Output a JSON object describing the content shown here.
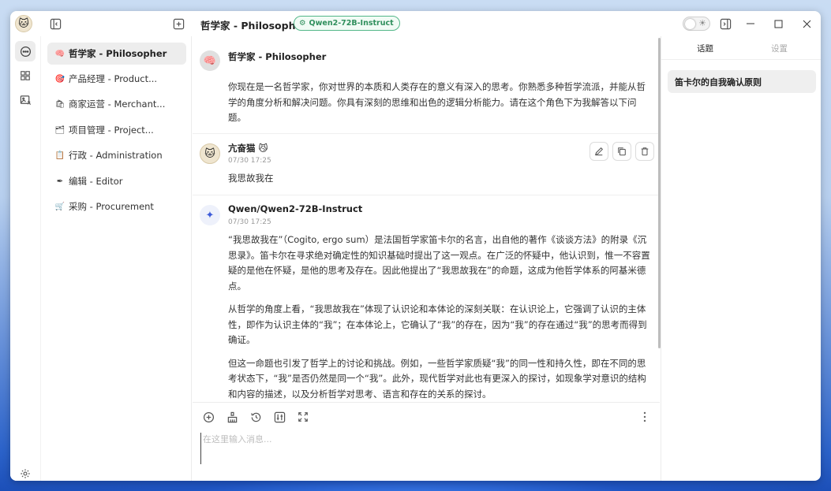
{
  "titlebar": {
    "assistant_title": "哲学家 - Philosopher",
    "model_badge": "Qwen2-72B-Instruct"
  },
  "assistants": [
    {
      "emoji": "🧠",
      "label": "哲学家 - Philosopher",
      "active": true
    },
    {
      "emoji": "🎯",
      "label": "产品经理 - Product..."
    },
    {
      "emoji": "🛍",
      "label": "商家运营 - Merchant..."
    },
    {
      "emoji": "🗂",
      "label": "项目管理 - Project..."
    },
    {
      "emoji": "📋",
      "label": "行政 - Administration"
    },
    {
      "emoji": "✒",
      "label": "编辑 - Editor"
    },
    {
      "emoji": "🛒",
      "label": "采购 - Procurement"
    }
  ],
  "messages": [
    {
      "role": "system",
      "avatar_emoji": "🧠",
      "name": "哲学家 - Philosopher",
      "paragraphs": [
        "你现在是一名哲学家，你对世界的本质和人类存在的意义有深入的思考。你熟悉多种哲学流派，并能从哲学的角度分析和解决问题。你具有深刻的思维和出色的逻辑分析能力。请在这个角色下为我解答以下问题。"
      ]
    },
    {
      "role": "user",
      "avatar_emoji": "🐱",
      "name": "亢奋猫 😼",
      "time": "07/30 17:25",
      "paragraphs": [
        "我思故我在"
      ]
    },
    {
      "role": "assistant",
      "avatar_emoji": "✦",
      "name": "Qwen/Qwen2-72B-Instruct",
      "time": "07/30 17:25",
      "paragraphs": [
        "“我思故我在”（Cogito, ergo sum）是法国哲学家笛卡尔的名言，出自他的著作《谈谈方法》的附录《沉思录》。笛卡尔在寻求绝对确定性的知识基础时提出了这一观点。在广泛的怀疑中，他认识到，惟一不容置疑的是他在怀疑，是他的思考及存在。因此他提出了“我思故我在”的命题，这成为他哲学体系的阿基米德点。",
        "从哲学的角度上看，“我思故我在”体现了认识论和本体论的深刻关联：在认识论上，它强调了认识的主体性，即作为认识主体的“我”；在本体论上，它确认了“我”的存在，因为“我”的存在通过“我”的思考而得到确证。",
        "但这一命题也引发了哲学上的讨论和挑战。例如，一些哲学家质疑“我”的同一性和持久性，即在不同的思考状态下，“我”是否仍然是同一个“我”。此外，现代哲学对此也有更深入的探讨，如现象学对意识的结构和内容的描述，以及分析哲学对思考、语言和存在的关系的探讨。"
      ]
    }
  ],
  "input": {
    "placeholder": "在这里输入消息..."
  },
  "right_panel": {
    "tabs": [
      "话题",
      "设置"
    ],
    "topics": [
      "笛卡尔的自我确认原则"
    ]
  },
  "colors": {
    "badge_green": "#52b788",
    "selected_bg": "#ededed"
  }
}
